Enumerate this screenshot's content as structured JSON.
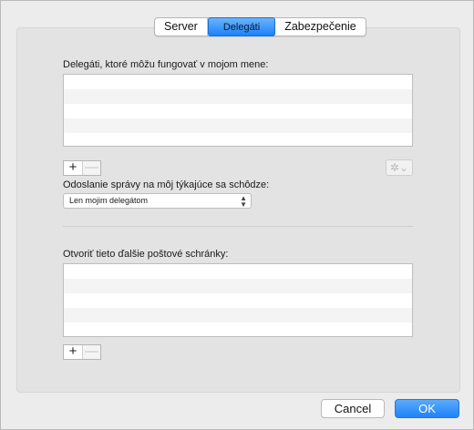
{
  "tabs": [
    {
      "label": "Server"
    },
    {
      "label": "Delegáti"
    },
    {
      "label": "Zabezpečenie"
    }
  ],
  "delegates": {
    "label": "Delegáti, ktoré môžu fungovať v mojom mene:",
    "add_label": "+",
    "remove_label": "—"
  },
  "gear": {
    "icon": "gear-icon",
    "glyph": "✲⌄"
  },
  "send_messages": {
    "label": "Odoslanie správy na môj týkajúce sa schôdze:",
    "selected": "Len mojim delegátom"
  },
  "mailboxes": {
    "label": "Otvoriť tieto ďalšie poštové schránky:",
    "add_label": "+",
    "remove_label": "—"
  },
  "buttons": {
    "cancel": "Cancel",
    "ok": "OK"
  },
  "colors": {
    "accent": "#1f83fb",
    "background": "#ececec"
  }
}
